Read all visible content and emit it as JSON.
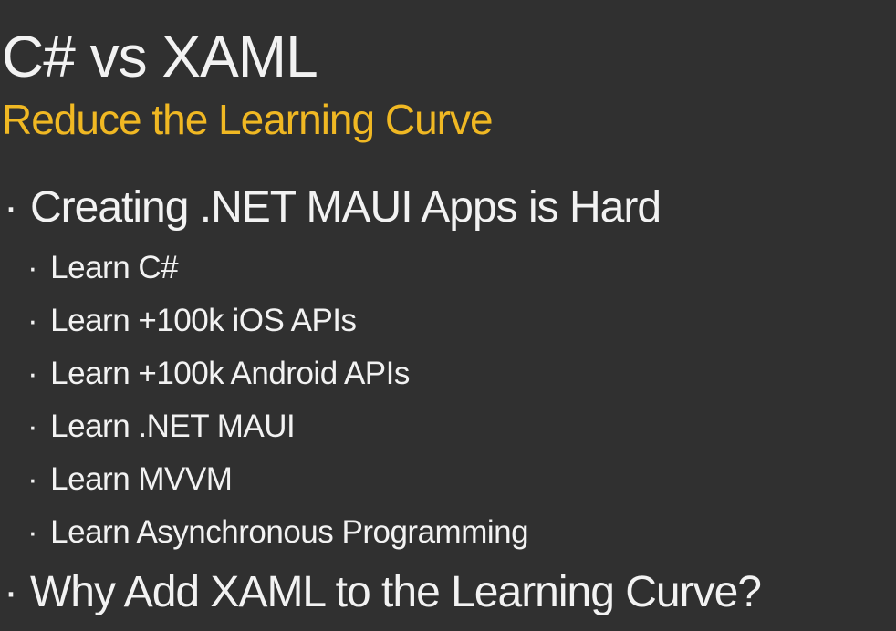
{
  "colors": {
    "background": "#303030",
    "title": "#f2f2f2",
    "subtitle": "#f0b823",
    "text": "#f2f2f2"
  },
  "slide": {
    "title": "C# vs XAML",
    "subtitle": "Reduce the Learning Curve",
    "bullet_glyph": "·",
    "bullet1": "Creating .NET MAUI Apps is Hard",
    "sub_bullets": [
      "Learn C#",
      "Learn +100k iOS APIs",
      "Learn +100k Android APIs",
      "Learn .NET MAUI",
      "Learn MVVM",
      "Learn Asynchronous Programming"
    ],
    "bullet2": "Why Add XAML to the Learning Curve?"
  }
}
